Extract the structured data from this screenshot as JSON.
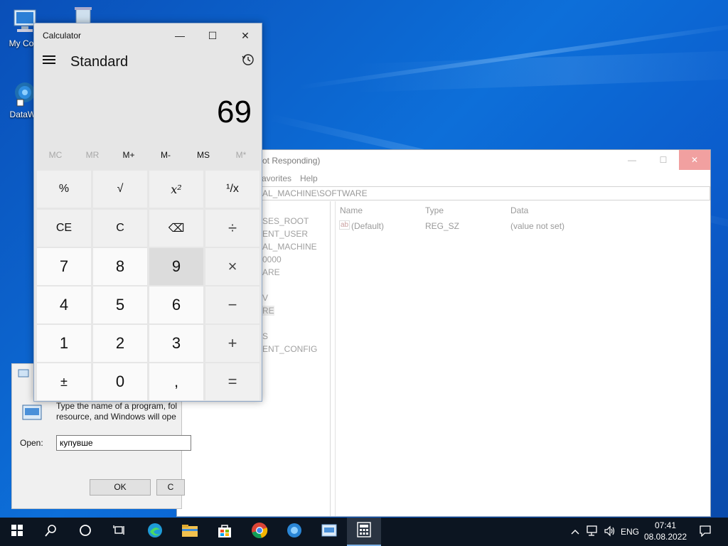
{
  "desktop": {
    "icons": [
      {
        "label": "My Com",
        "icon": "computer-icon"
      },
      {
        "label": "DataWa",
        "icon": "datawarehouse-icon"
      }
    ]
  },
  "registry": {
    "title_fragment": "ot Responding)",
    "close_label": "✕",
    "min_label": "—",
    "max_label": "☐",
    "menu": [
      "avorites",
      "Help"
    ],
    "address": "AL_MACHINE\\SOFTWARE",
    "tree": [
      "SES_ROOT",
      "ENT_USER",
      "AL_MACHINE",
      "0000",
      "ARE",
      "V",
      "RE",
      "S",
      "ENT_CONFIG"
    ],
    "columns": {
      "name": "Name",
      "type": "Type",
      "data": "Data"
    },
    "rows": [
      {
        "name": "(Default)",
        "type": "REG_SZ",
        "data": "(value not set)"
      }
    ]
  },
  "run": {
    "description_line1": "Type the name of a program, fol",
    "description_line2": "resource, and Windows will ope",
    "open_label": "Open:",
    "input_value": "купувше",
    "ok_label": "OK",
    "cancel_label": "C"
  },
  "calculator": {
    "title": "Calculator",
    "mode": "Standard",
    "display": "69",
    "memory": [
      {
        "label": "MC",
        "enabled": false
      },
      {
        "label": "MR",
        "enabled": false
      },
      {
        "label": "M+",
        "enabled": true
      },
      {
        "label": "M-",
        "enabled": true
      },
      {
        "label": "MS",
        "enabled": true
      },
      {
        "label": "M*",
        "enabled": false
      }
    ],
    "keys": [
      [
        "%",
        "√",
        "x²",
        "¹/x"
      ],
      [
        "CE",
        "C",
        "⌫",
        "÷"
      ],
      [
        "7",
        "8",
        "9",
        "×"
      ],
      [
        "4",
        "5",
        "6",
        "−"
      ],
      [
        "1",
        "2",
        "3",
        "+"
      ],
      [
        "±",
        "0",
        ",",
        "="
      ]
    ]
  },
  "taskbar": {
    "language": "ENG",
    "time": "07:41",
    "date": "08.08.2022",
    "apps": [
      "start-icon",
      "search-icon",
      "cortana-icon",
      "task-view-icon",
      "edge-icon",
      "file-explorer-icon",
      "store-icon",
      "chrome-icon",
      "datawarehouse-icon",
      "run-icon",
      "calculator-icon"
    ]
  }
}
